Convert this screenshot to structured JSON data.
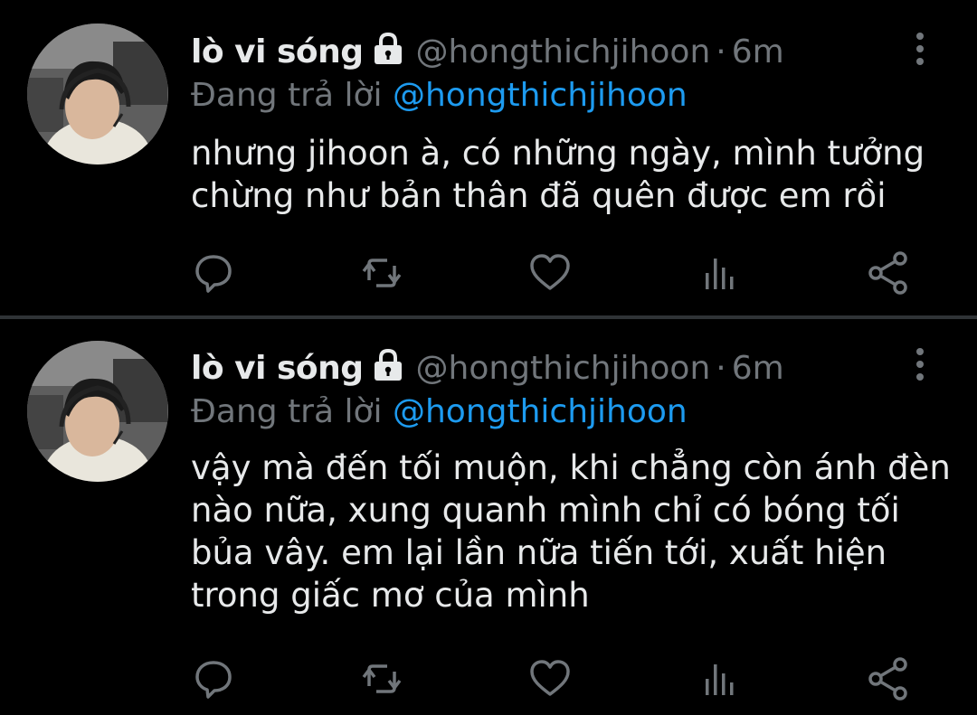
{
  "colors": {
    "background": "#000000",
    "divider": "#2f3336",
    "primary_text": "#e7e9ea",
    "secondary_text": "#71767b",
    "link": "#1d9bf0"
  },
  "tweets": [
    {
      "author_name": "lò vi sóng",
      "locked_icon": "lock-icon",
      "handle": "@hongthichjihoon",
      "separator": "·",
      "time": "6m",
      "reply_prefix": "Đang trả lời",
      "reply_to": "@hongthichjihoon",
      "text_lines": [
        "nhưng jihoon à, có những ngày, mình tưởng",
        "chừng như bản thân đã quên được em rồi"
      ],
      "actions": [
        "reply-icon",
        "retweet-icon",
        "like-icon",
        "views-icon",
        "share-icon"
      ]
    },
    {
      "author_name": "lò vi sóng",
      "locked_icon": "lock-icon",
      "handle": "@hongthichjihoon",
      "separator": "·",
      "time": "6m",
      "reply_prefix": "Đang trả lời",
      "reply_to": "@hongthichjihoon",
      "text_lines": [
        "vậy mà đến tối muộn, khi chẳng còn ánh đèn",
        "nào nữa, xung quanh mình chỉ có bóng tối",
        "bủa vây. em lại lần nữa tiến tới, xuất hiện",
        "trong giấc mơ của mình"
      ],
      "actions": [
        "reply-icon",
        "retweet-icon",
        "like-icon",
        "views-icon",
        "share-icon"
      ]
    }
  ]
}
